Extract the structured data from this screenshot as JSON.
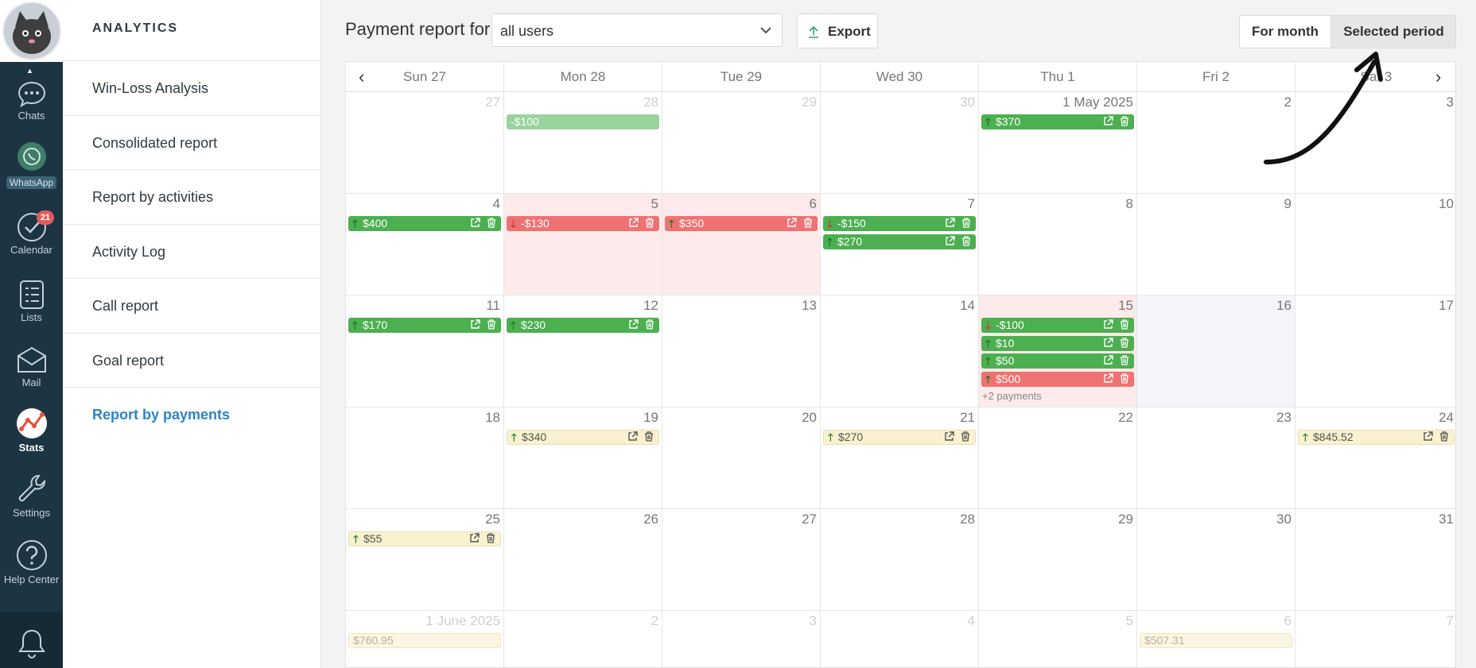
{
  "rail": {
    "items": [
      {
        "label": "Chats",
        "icon": "chats-icon"
      },
      {
        "label": "WhatsApp",
        "icon": "whatsapp-icon"
      },
      {
        "label": "Calendar",
        "icon": "calendar-check-icon",
        "badge": "21"
      },
      {
        "label": "Lists",
        "icon": "lists-icon"
      },
      {
        "label": "Mail",
        "icon": "mail-icon"
      },
      {
        "label": "Stats",
        "icon": "stats-icon",
        "active": true
      },
      {
        "label": "Settings",
        "icon": "wrench-icon"
      },
      {
        "label": "Help Center",
        "icon": "help-icon"
      }
    ],
    "bell_icon": "bell-icon"
  },
  "sidebar": {
    "title": "ANALYTICS",
    "items": [
      {
        "label": "Win-Loss Analysis"
      },
      {
        "label": "Consolidated report"
      },
      {
        "label": "Report by activities"
      },
      {
        "label": "Activity Log"
      },
      {
        "label": "Call report"
      },
      {
        "label": "Goal report"
      },
      {
        "label": "Report by payments",
        "active": true
      }
    ]
  },
  "toolbar": {
    "title": "Payment report for",
    "user_select": "all users",
    "export_label": "Export",
    "period_options": [
      "For month",
      "Selected period"
    ],
    "period_selected": "For month"
  },
  "calendar": {
    "day_names": [
      "Sun 27",
      "Mon 28",
      "Tue 29",
      "Wed 30",
      "Thu 1",
      "Fri 2",
      "Sat 3"
    ],
    "weeks": [
      [
        {
          "day": "27",
          "dim": true
        },
        {
          "day": "28",
          "dim": true,
          "payments": [
            {
              "amount": "-$100",
              "style": "lgreen",
              "dir": "none"
            }
          ]
        },
        {
          "day": "29",
          "dim": true
        },
        {
          "day": "30",
          "dim": true
        },
        {
          "day": "1 May 2025",
          "payments": [
            {
              "amount": "$370",
              "style": "green",
              "dir": "up"
            }
          ]
        },
        {
          "day": "2"
        },
        {
          "day": "3"
        }
      ],
      [
        {
          "day": "4",
          "payments": [
            {
              "amount": "$400",
              "style": "green",
              "dir": "up"
            }
          ]
        },
        {
          "day": "5",
          "bg": "pink",
          "payments": [
            {
              "amount": "-$130",
              "style": "red",
              "dir": "down"
            }
          ]
        },
        {
          "day": "6",
          "bg": "pink",
          "payments": [
            {
              "amount": "$350",
              "style": "red",
              "dir": "up"
            }
          ]
        },
        {
          "day": "7",
          "payments": [
            {
              "amount": "-$150",
              "style": "green",
              "dir": "down"
            },
            {
              "amount": "$270",
              "style": "green",
              "dir": "up"
            }
          ]
        },
        {
          "day": "8"
        },
        {
          "day": "9"
        },
        {
          "day": "10"
        }
      ],
      [
        {
          "day": "11",
          "payments": [
            {
              "amount": "$170",
              "style": "green",
              "dir": "up"
            }
          ]
        },
        {
          "day": "12",
          "payments": [
            {
              "amount": "$230",
              "style": "green",
              "dir": "up"
            }
          ]
        },
        {
          "day": "13"
        },
        {
          "day": "14"
        },
        {
          "day": "15",
          "bg": "pink",
          "payments": [
            {
              "amount": "-$100",
              "style": "green",
              "dir": "down"
            },
            {
              "amount": "$10",
              "style": "green",
              "dir": "up"
            },
            {
              "amount": "$50",
              "style": "green",
              "dir": "up"
            },
            {
              "amount": "$500",
              "style": "red",
              "dir": "up"
            }
          ],
          "more": "+2 payments"
        },
        {
          "day": "16",
          "bg": "blue"
        },
        {
          "day": "17"
        }
      ],
      [
        {
          "day": "18"
        },
        {
          "day": "19",
          "payments": [
            {
              "amount": "$340",
              "style": "yellow",
              "dir": "up"
            }
          ]
        },
        {
          "day": "20"
        },
        {
          "day": "21",
          "payments": [
            {
              "amount": "$270",
              "style": "yellow",
              "dir": "up"
            }
          ]
        },
        {
          "day": "22"
        },
        {
          "day": "23"
        },
        {
          "day": "24",
          "payments": [
            {
              "amount": "$845.52",
              "style": "yellow",
              "dir": "up"
            }
          ]
        }
      ],
      [
        {
          "day": "25",
          "payments": [
            {
              "amount": "$55",
              "style": "yellow",
              "dir": "up"
            }
          ]
        },
        {
          "day": "26"
        },
        {
          "day": "27"
        },
        {
          "day": "28"
        },
        {
          "day": "29"
        },
        {
          "day": "30"
        },
        {
          "day": "31"
        }
      ],
      [
        {
          "day": "1 June 2025",
          "dim": true,
          "payments": [
            {
              "amount": "$760.95",
              "style": "ghost",
              "dir": "none"
            }
          ]
        },
        {
          "day": "2",
          "dim": true
        },
        {
          "day": "3",
          "dim": true
        },
        {
          "day": "4",
          "dim": true
        },
        {
          "day": "5",
          "dim": true
        },
        {
          "day": "6",
          "dim": true,
          "payments": [
            {
              "amount": "$507.31",
              "style": "ghost",
              "dir": "none"
            }
          ]
        },
        {
          "day": "7",
          "dim": true
        }
      ]
    ]
  }
}
